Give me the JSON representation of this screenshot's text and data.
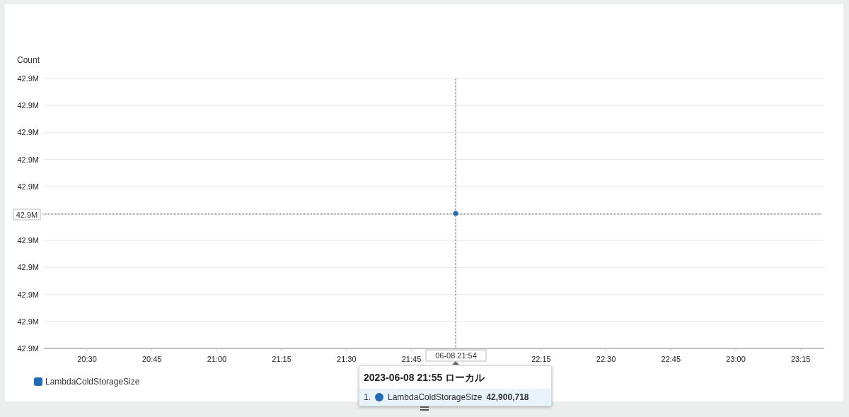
{
  "y_axis": {
    "title": "Count",
    "tick_labels": [
      "42.9M",
      "42.9M",
      "42.9M",
      "42.9M",
      "42.9M",
      "42.9M",
      "42.9M",
      "42.9M",
      "42.9M",
      "42.9M"
    ]
  },
  "x_axis": {
    "tick_labels": [
      "20:30",
      "20:45",
      "21:00",
      "21:15",
      "21:30",
      "21:45",
      "22:15",
      "22:30",
      "22:45",
      "23:00",
      "23:15"
    ]
  },
  "crosshair": {
    "y_label": "42.9M",
    "x_label": "06-08 21:54"
  },
  "legend": [
    {
      "name": "LambdaColdStorageSize",
      "color": "#1f6db4"
    }
  ],
  "tooltip": {
    "title": "2023-06-08 21:55 ローカル",
    "rows": [
      {
        "index": "1.",
        "name": "LambdaColdStorageSize",
        "value": "42,900,718",
        "color": "#1f6db4"
      }
    ]
  }
}
